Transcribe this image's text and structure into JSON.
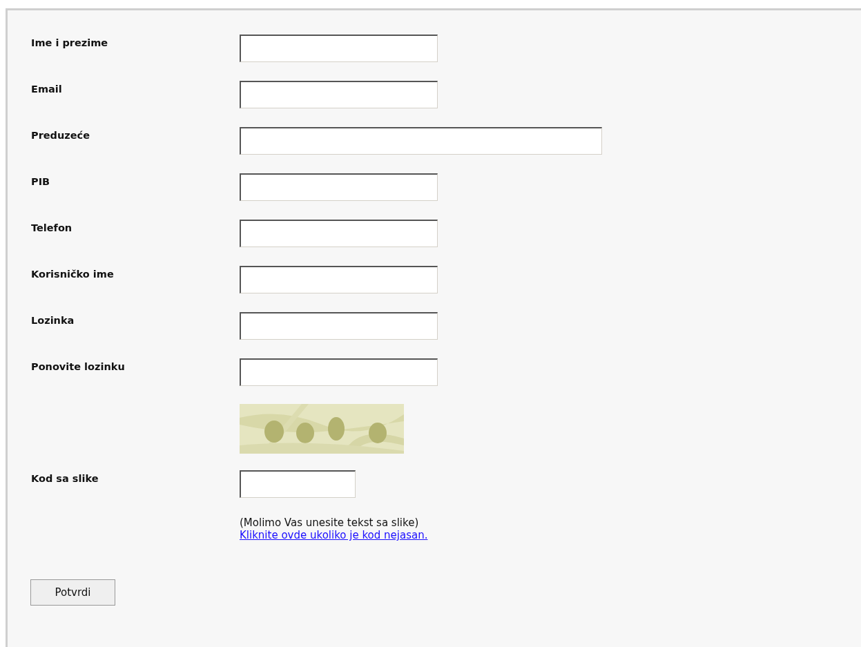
{
  "fields": [
    {
      "label": "Ime i prezime",
      "kind": "normal"
    },
    {
      "label": "Email",
      "kind": "normal"
    },
    {
      "label": "Preduzeće",
      "kind": "wide"
    },
    {
      "label": "PIB",
      "kind": "normal"
    },
    {
      "label": "Telefon",
      "kind": "normal"
    },
    {
      "label": "Korisničko ime",
      "kind": "normal"
    },
    {
      "label": "Lozinka",
      "kind": "normal"
    },
    {
      "label": "Ponovite lozinku",
      "kind": "normal"
    }
  ],
  "code": {
    "label": "Kod sa slike"
  },
  "hint": "(Molimo Vas unesite tekst sa slike)",
  "link": "Kliknite ovde ukoliko je kod nejasan.",
  "submit": "Potvrdi"
}
